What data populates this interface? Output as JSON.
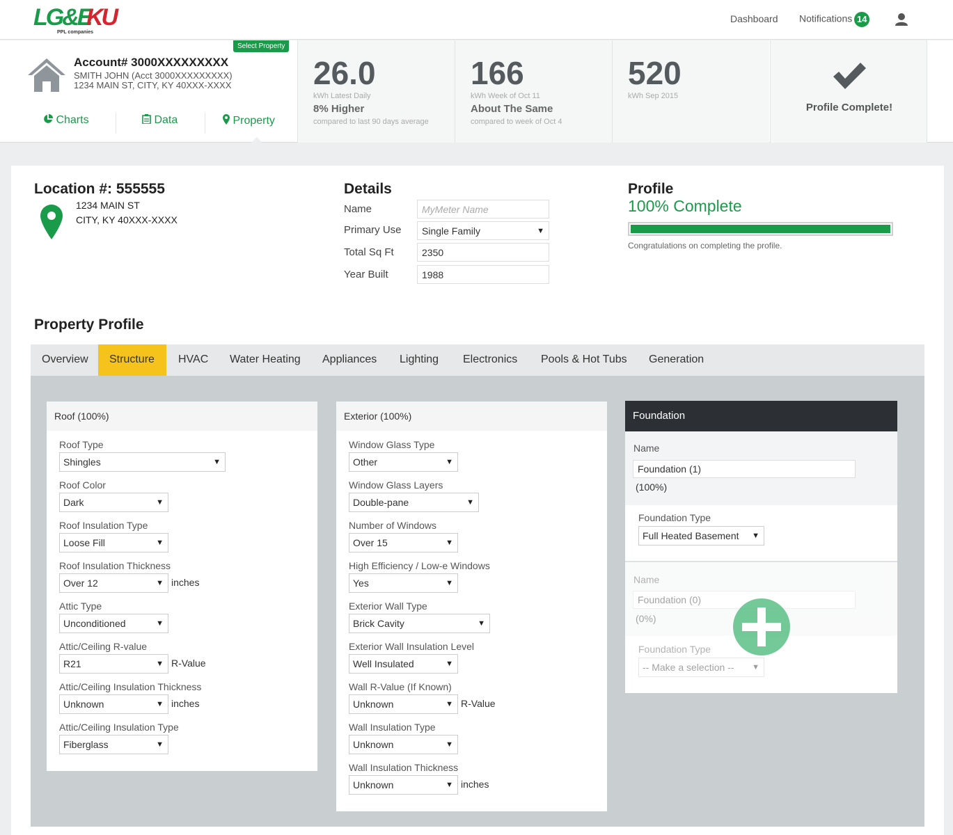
{
  "brand": {
    "logo_main": "LG&E",
    "logo_secondary": "KU",
    "logo_sub": "PPL companies",
    "color": "#1a9b4a"
  },
  "topnav": {
    "dashboard": "Dashboard",
    "notifications": "Notifications",
    "notification_count": "14"
  },
  "account": {
    "select_property": "Select Property",
    "number": "Account# 3000XXXXXXXXX",
    "holder": "SMITH JOHN  (Acct 3000XXXXXXXXX)",
    "address": "1234 MAIN ST, CITY, KY 40XXX-XXXX",
    "tabs": {
      "charts": "Charts",
      "data": "Data",
      "property": "Property"
    }
  },
  "stats": [
    {
      "value": "26.0",
      "label": "kWh Latest Daily",
      "change": "8% Higher",
      "note": "compared to last 90 days average"
    },
    {
      "value": "166",
      "label": "kWh Week of Oct 11",
      "change": "About The Same",
      "note": "compared to week of Oct 4"
    },
    {
      "value": "520",
      "label": "kWh Sep 2015",
      "change": "",
      "note": ""
    }
  ],
  "profile_stat": {
    "label": "Profile Complete!"
  },
  "location": {
    "title": "Location #:  555555",
    "line1": "1234 MAIN ST",
    "line2": "CITY, KY 40XXX-XXXX"
  },
  "details": {
    "title": "Details",
    "name_label": "Name",
    "name_placeholder": "MyMeter Name",
    "use_label": "Primary Use",
    "use_value": "Single Family",
    "sqft_label": "Total Sq Ft",
    "sqft_value": "2350",
    "year_label": "Year Built",
    "year_value": "1988"
  },
  "profile": {
    "title": "Profile",
    "percent_text": "100% Complete",
    "percent": 1.0,
    "note": "Congratulations on completing the profile."
  },
  "property_profile": {
    "title": "Property Profile",
    "tabs": [
      "Overview",
      "Structure",
      "HVAC",
      "Water Heating",
      "Appliances",
      "Lighting",
      "Electronics",
      "Pools & Hot Tubs",
      "Generation"
    ],
    "active_tab": "Structure"
  },
  "roof": {
    "title": "Roof (100%)",
    "fields": [
      {
        "label": "Roof Type",
        "value": "Shingles",
        "unit": ""
      },
      {
        "label": "Roof Color",
        "value": "Dark",
        "unit": ""
      },
      {
        "label": "Roof Insulation Type",
        "value": "Loose Fill",
        "unit": ""
      },
      {
        "label": "Roof Insulation Thickness",
        "value": "Over 12",
        "unit": "inches"
      },
      {
        "label": "Attic Type",
        "value": "Unconditioned",
        "unit": ""
      },
      {
        "label": "Attic/Ceiling R-value",
        "value": "R21",
        "unit": "R-Value"
      },
      {
        "label": "Attic/Ceiling Insulation Thickness",
        "value": "Unknown",
        "unit": "inches"
      },
      {
        "label": "Attic/Ceiling Insulation Type",
        "value": "Fiberglass",
        "unit": ""
      }
    ]
  },
  "exterior": {
    "title": "Exterior (100%)",
    "fields": [
      {
        "label": "Window Glass Type",
        "value": "Other",
        "unit": ""
      },
      {
        "label": "Window Glass Layers",
        "value": "Double-pane",
        "unit": ""
      },
      {
        "label": "Number of Windows",
        "value": "Over 15",
        "unit": ""
      },
      {
        "label": "High Efficiency / Low-e Windows",
        "value": "Yes",
        "unit": ""
      },
      {
        "label": "Exterior Wall Type",
        "value": "Brick Cavity",
        "unit": ""
      },
      {
        "label": "Exterior Wall Insulation Level",
        "value": "Well Insulated",
        "unit": ""
      },
      {
        "label": "Wall R-Value (If Known)",
        "value": "Unknown",
        "unit": "R-Value"
      },
      {
        "label": "Wall Insulation Type",
        "value": "Unknown",
        "unit": ""
      },
      {
        "label": "Wall Insulation Thickness",
        "value": "Unknown",
        "unit": "inches"
      }
    ]
  },
  "foundation": {
    "title": "Foundation",
    "items": [
      {
        "name_label": "Name",
        "name_value": "Foundation (1)",
        "percent": "(100%)",
        "type_label": "Foundation Type",
        "type_value": "Full Heated Basement"
      },
      {
        "name_label": "Name",
        "name_value": "Foundation (0)",
        "percent": "(0%)",
        "type_label": "Foundation Type",
        "type_value": "-- Make a selection --"
      }
    ]
  }
}
